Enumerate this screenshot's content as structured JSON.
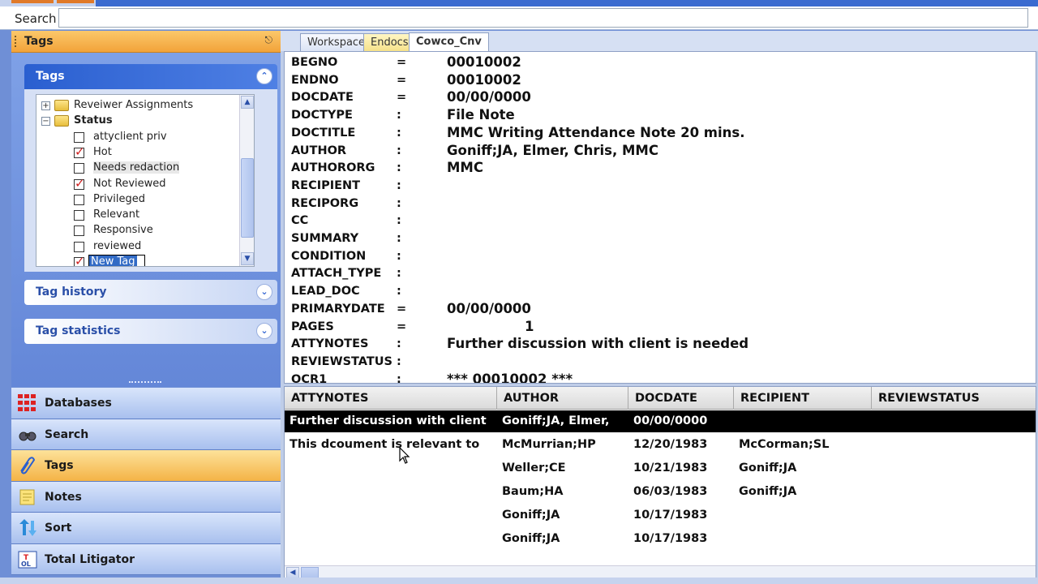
{
  "search": {
    "label": "Search",
    "value": ""
  },
  "tags_panel": {
    "title": "Tags",
    "pin_icon": "pin-icon",
    "groups": {
      "tags": {
        "title": "Tags"
      },
      "history": {
        "title": "Tag history"
      },
      "statistics": {
        "title": "Tag statistics"
      }
    },
    "tree": {
      "nodes": [
        {
          "label": "Reveiwer Assignments",
          "type": "folder",
          "expanded": false
        },
        {
          "label": "Status",
          "type": "folder",
          "expanded": true
        },
        {
          "label": "attyclient priv",
          "checked": false
        },
        {
          "label": "Hot",
          "checked": true
        },
        {
          "label": "Needs redaction",
          "checked": false
        },
        {
          "label": "Not Reviewed",
          "checked": true
        },
        {
          "label": "Privileged",
          "checked": false
        },
        {
          "label": "Relevant",
          "checked": false
        },
        {
          "label": "Responsive",
          "checked": false
        },
        {
          "label": "reviewed",
          "checked": false
        },
        {
          "label": "New Tag",
          "checked": true,
          "editing": true
        }
      ]
    }
  },
  "nav": [
    {
      "label": "Databases",
      "icon": "databases-icon",
      "active": false
    },
    {
      "label": "Search",
      "icon": "search-binoculars-icon",
      "active": false
    },
    {
      "label": "Tags",
      "icon": "tags-clip-icon",
      "active": true
    },
    {
      "label": "Notes",
      "icon": "notes-icon",
      "active": false
    },
    {
      "label": "Sort",
      "icon": "sort-arrows-icon",
      "active": false
    },
    {
      "label": "Total Litigator",
      "icon": "total-litigator-icon",
      "active": false
    }
  ],
  "tabs": [
    {
      "label": "Workspace",
      "active": false
    },
    {
      "label": "Endocs",
      "active": false
    },
    {
      "label": "Cowco_Cnv",
      "active": true
    }
  ],
  "fields": [
    {
      "name": "BEGNO",
      "sep": "=",
      "value": "00010002"
    },
    {
      "name": "ENDNO",
      "sep": "=",
      "value": "00010002"
    },
    {
      "name": "DOCDATE",
      "sep": "=",
      "value": "00/00/0000"
    },
    {
      "name": "DOCTYPE",
      "sep": ":",
      "value": "File Note"
    },
    {
      "name": "DOCTITLE",
      "sep": ":",
      "value": "MMC Writing Attendance Note 20 mins."
    },
    {
      "name": "AUTHOR",
      "sep": ":",
      "value": "Goniff;JA, Elmer, Chris, MMC"
    },
    {
      "name": "AUTHORORG",
      "sep": ":",
      "value": "MMC"
    },
    {
      "name": "RECIPIENT",
      "sep": ":",
      "value": ""
    },
    {
      "name": "RECIPORG",
      "sep": ":",
      "value": ""
    },
    {
      "name": "CC",
      "sep": ":",
      "value": ""
    },
    {
      "name": "SUMMARY",
      "sep": ":",
      "value": ""
    },
    {
      "name": "CONDITION",
      "sep": ":",
      "value": ""
    },
    {
      "name": "ATTACH_TYPE",
      "sep": ":",
      "value": ""
    },
    {
      "name": "LEAD_DOC",
      "sep": ":",
      "value": ""
    },
    {
      "name": "PRIMARYDATE",
      "sep": "=",
      "value": "00/00/0000"
    },
    {
      "name": "PAGES",
      "sep": "=",
      "value": "1"
    },
    {
      "name": "ATTYNOTES",
      "sep": ":",
      "value": "Further discussion with client is needed"
    },
    {
      "name": "REVIEWSTATUS",
      "sep": ":",
      "value": ""
    },
    {
      "name": "OCR1",
      "sep": ":",
      "value": "*** 00010002 ***"
    }
  ],
  "grid": {
    "columns": [
      "ATTYNOTES",
      "AUTHOR",
      "DOCDATE",
      "RECIPIENT",
      "REVIEWSTATUS"
    ],
    "rows": [
      {
        "cells": [
          "Further discussion with client",
          "Goniff;JA, Elmer,",
          "00/00/0000",
          "",
          ""
        ],
        "selected": true
      },
      {
        "cells": [
          "This dcoument is relevant to",
          "McMurrian;HP",
          "12/20/1983",
          "McCorman;SL",
          ""
        ],
        "selected": false
      },
      {
        "cells": [
          "",
          "Weller;CE",
          "10/21/1983",
          "Goniff;JA",
          ""
        ],
        "selected": false
      },
      {
        "cells": [
          "",
          "Baum;HA",
          "06/03/1983",
          "Goniff;JA",
          ""
        ],
        "selected": false
      },
      {
        "cells": [
          "",
          "Goniff;JA",
          "10/17/1983",
          "",
          ""
        ],
        "selected": false
      },
      {
        "cells": [
          "",
          "Goniff;JA",
          "10/17/1983",
          "",
          ""
        ],
        "selected": false
      }
    ]
  },
  "colors": {
    "accent_orange": "#f4b346",
    "pane_blue": "#6f8fd6",
    "check_red": "#d02020",
    "selected_row": "#000000"
  }
}
